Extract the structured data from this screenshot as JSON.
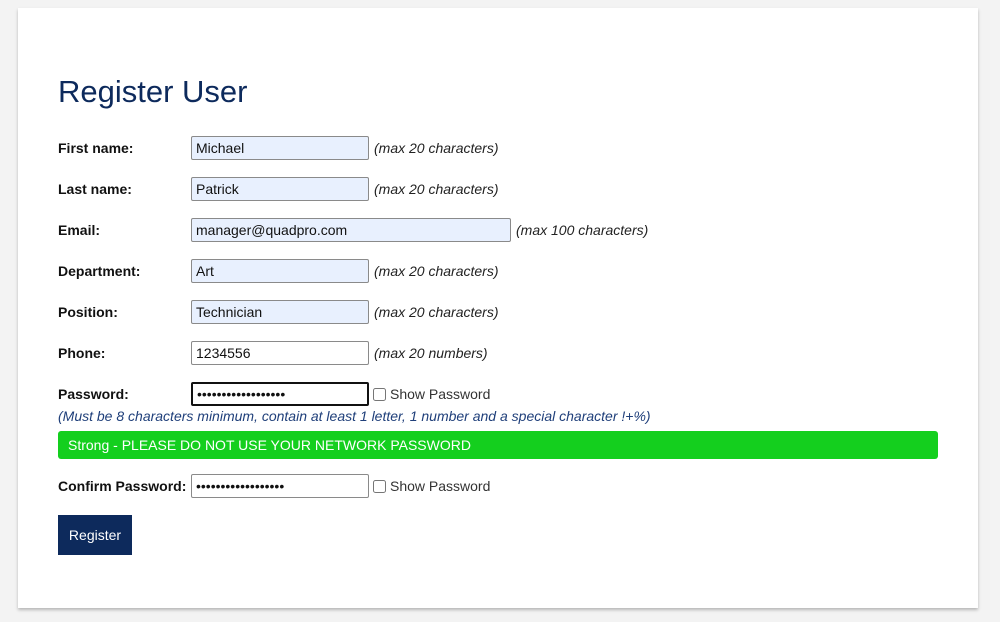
{
  "page": {
    "title": "Register User"
  },
  "form": {
    "first_name": {
      "label": "First name:",
      "value": "Michael",
      "hint": "(max 20 characters)"
    },
    "last_name": {
      "label": "Last name:",
      "value": "Patrick",
      "hint": "(max 20 characters)"
    },
    "email": {
      "label": "Email:",
      "value": "manager@quadpro.com",
      "hint": "(max 100 characters)"
    },
    "department": {
      "label": "Department:",
      "value": "Art",
      "hint": "(max 20 characters)"
    },
    "position": {
      "label": "Position:",
      "value": "Technician",
      "hint": "(max 20 characters)"
    },
    "phone": {
      "label": "Phone:",
      "value": "1234556",
      "hint": "(max 20 numbers)"
    },
    "password": {
      "label": "Password:",
      "value": "••••••••••••••••••",
      "show_label": "Show Password"
    },
    "password_rules": "(Must be 8 characters minimum, contain at least 1 letter, 1 number and a special character !+%)",
    "strength_message": "Strong - PLEASE DO NOT USE YOUR NETWORK PASSWORD",
    "confirm_password": {
      "label": "Confirm Password:",
      "value": "••••••••••••••••••",
      "show_label": "Show Password"
    },
    "submit_label": "Register"
  },
  "colors": {
    "title": "#0d2a5c",
    "strength_bar": "#14cf1e",
    "button": "#0d2a5c",
    "autofill_bg": "#e8f0fe"
  }
}
